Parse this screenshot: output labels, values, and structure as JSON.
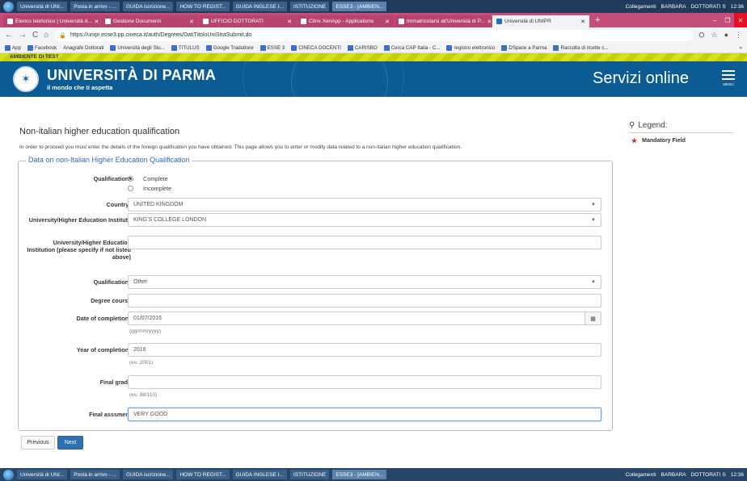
{
  "taskbar_top": {
    "items": [
      "Università di UNI...",
      "Posta in arrivo - ...",
      "GUIDA iscrizione...",
      "HOW TO REGIST...",
      "GUIDA INGLESE I...",
      "ISTITUZIONE",
      "ESSE3 - [AMBIEN...",
      "Collegamenti",
      "BARBARA",
      "DOTTORATI S"
    ],
    "clock": "12:36"
  },
  "taskbar_bottom": {
    "items": [
      "Università di UNI...",
      "Posta in arrivo - ...",
      "GUIDA iscrizione...",
      "HOW TO REGIST...",
      "GUIDA INGLESE I...",
      "ISTITUZIONE",
      "ESSE3 - [AMBIEN...",
      "Collegamenti",
      "BARBARA",
      "DOTTORATI S"
    ],
    "clock": "12:36"
  },
  "tabs": [
    "Elenco telefonico | Università d...",
    "Gestione Documenti",
    "UFFICIO DOTTORATI",
    "Citrix XenApp - Applications",
    "Immatricolarsi all'Università di P...",
    "Università di UNIPR"
  ],
  "url": "https://unipr.esse3.pp.cineca.it/auth/Degrees/DatiTitoloUniStraSubmit.do",
  "bookmarks": [
    "App",
    "Facebook",
    "Anagrafe Dottorati",
    "Università degli Stu...",
    "TITULUS",
    "Google Traduttore",
    "ESSE 3",
    "CINECA DOCENTI",
    "CARISBO",
    "Cerca CAP Italia - C...",
    "registro elettronico",
    "DSpace a Parma",
    "Raccolta di ricette c..."
  ],
  "env_label": "AMBIENTE DI TEST",
  "header": {
    "university": "UNIVERSITÀ DI PARMA",
    "motto": "il mondo che ti aspetta",
    "servizi": "Servizi online",
    "menu": "MENU"
  },
  "page": {
    "title": "Non-italian higher education qualification",
    "intro": "In order to proceed you must enter the details of the foreign qualification you have obtained. This page allows you to enter or modify data related to a non-italian higher education qualification.",
    "fieldset_legend": "Data on non-Italian Higher Education Qualification"
  },
  "form": {
    "qualification_status": {
      "label": "Qualification*",
      "options": [
        "Complete",
        "Incomplete"
      ],
      "selected": "Complete"
    },
    "country": {
      "label": "Country*",
      "value": "UNITED KINGDOM"
    },
    "university": {
      "label": "University/Higher Education Institute",
      "value": "KING'S COLLEGE LONDON"
    },
    "university_other": {
      "label": "University/Higher Education Institution (please specify if not listed above)",
      "value": ""
    },
    "qualification": {
      "label": "Qualification*",
      "value": "Other"
    },
    "degree_course": {
      "label": "Degree course",
      "value": ""
    },
    "date_completion": {
      "label": "Date of completion*",
      "value": "01/07/2016",
      "hint": "(gg/mm/yyyy)"
    },
    "year_completion": {
      "label": "Year of completion*",
      "value": "2016",
      "hint": "(es: 2001)"
    },
    "final_grade": {
      "label": "Final grade",
      "value": "",
      "hint": "(es: 98/110)"
    },
    "final_assessment": {
      "label": "Final asssment",
      "value": "VERY GOOD"
    }
  },
  "legend": {
    "title": "Legend:",
    "mandatory": "Mandatory Field"
  },
  "buttons": {
    "previous": "Previous",
    "next": "Next"
  }
}
